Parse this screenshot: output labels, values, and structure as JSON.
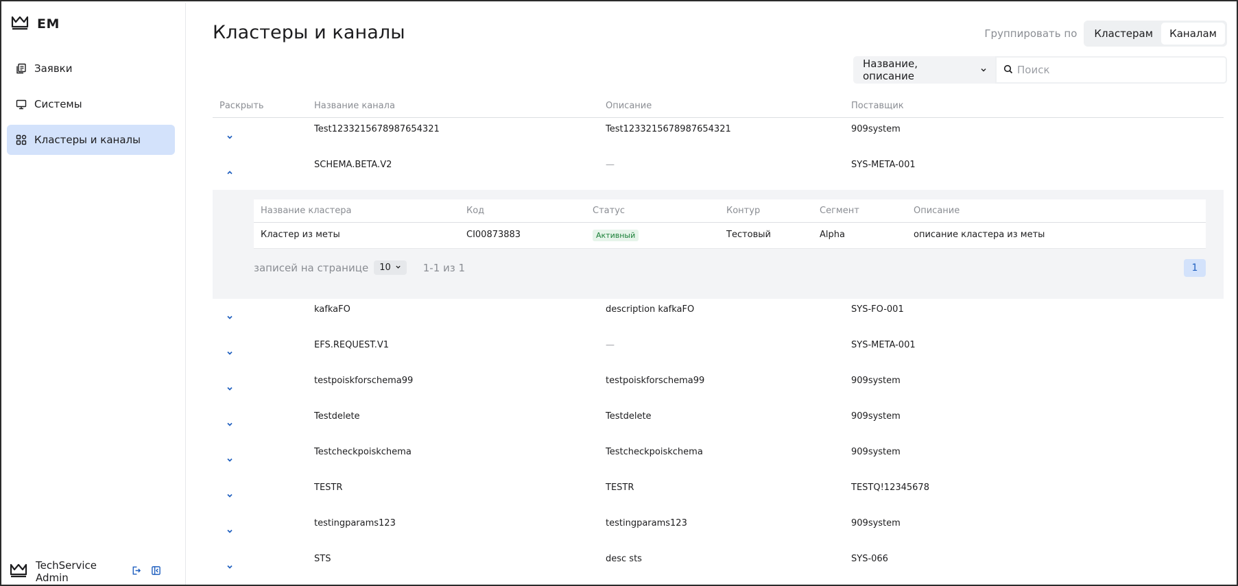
{
  "app": {
    "logo_text": "EM"
  },
  "sidebar": {
    "items": [
      {
        "label": "Заявки",
        "icon": "documents-icon",
        "active": false
      },
      {
        "label": "Системы",
        "icon": "monitor-icon",
        "active": false
      },
      {
        "label": "Кластеры и каналы",
        "icon": "grid-icon",
        "active": true
      }
    ],
    "user": {
      "name": "TechService Admin"
    }
  },
  "page": {
    "title": "Кластеры и каналы",
    "group_by_label": "Группировать по",
    "group_options": [
      "Кластерам",
      "Каналам"
    ],
    "group_selected": "Каналам",
    "search_field_select": "Название, описание",
    "search_placeholder": "Поиск"
  },
  "table": {
    "headers": {
      "expand": "Раскрыть",
      "name": "Название канала",
      "description": "Описание",
      "provider": "Поставщик"
    },
    "rows": [
      {
        "name": "Test1233215678987654321",
        "description": "Test1233215678987654321",
        "provider": "909system"
      },
      {
        "name": "SCHEMA.BETA.V2",
        "description": "—",
        "provider": "SYS-META-001"
      },
      {
        "name": "kafkaFO",
        "description": "description kafkaFO",
        "provider": "SYS-FO-001"
      },
      {
        "name": "EFS.REQUEST.V1",
        "description": "—",
        "provider": "SYS-META-001"
      },
      {
        "name": "testpoiskforschema99",
        "description": "testpoiskforschema99",
        "provider": "909system"
      },
      {
        "name": "Testdelete",
        "description": "Testdelete",
        "provider": "909system"
      },
      {
        "name": "Testcheckpoiskchema",
        "description": "Testcheckpoiskchema",
        "provider": "909system"
      },
      {
        "name": "TESTR",
        "description": "TESTR",
        "provider": "TESTQ!12345678"
      },
      {
        "name": "testingparams123",
        "description": "testingparams123",
        "provider": "909system"
      },
      {
        "name": "STS",
        "description": "desc sts",
        "provider": "SYS-066"
      }
    ],
    "expanded": {
      "headers": {
        "name": "Название кластера",
        "code": "Код",
        "status": "Статус",
        "contour": "Контур",
        "segment": "Сегмент",
        "description": "Описание"
      },
      "row": {
        "name": "Кластер из меты",
        "code": "CI00873883",
        "status": "Активный",
        "contour": "Тестовый",
        "segment": "Alpha",
        "description": "описание кластера из меты"
      },
      "pager": {
        "per_page_label": "записей на странице",
        "per_page_value": "10",
        "range": "1-1 из 1",
        "page": "1"
      }
    }
  },
  "colors": {
    "accent": "#1f5fbf",
    "active_nav": "#d3e2fb",
    "status_active_bg": "#e6f4ea",
    "status_active_text": "#1a7f37"
  }
}
